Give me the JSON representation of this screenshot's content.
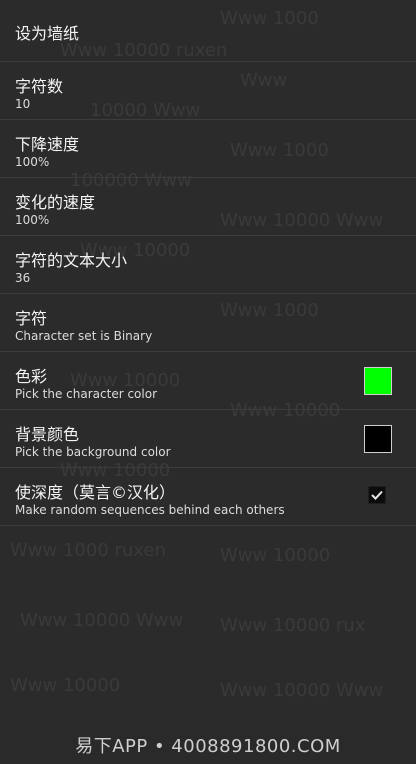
{
  "settings": {
    "items": [
      {
        "title": "设为墙纸"
      },
      {
        "title": "字符数",
        "subtitle": "10"
      },
      {
        "title": "下降速度",
        "subtitle": "100%"
      },
      {
        "title": "变化的速度",
        "subtitle": "100%"
      },
      {
        "title": "字符的文本大小",
        "subtitle": "36"
      },
      {
        "title": "字符",
        "subtitle": "Character set is Binary"
      },
      {
        "title": "色彩",
        "subtitle": "Pick the character color",
        "color": "#00ff00"
      },
      {
        "title": "背景颜色",
        "subtitle": "Pick the background color",
        "color": "#000000"
      },
      {
        "title": "使深度（莫言©汉化）",
        "subtitle": "Make random sequences behind each others",
        "checked": true
      }
    ]
  },
  "footer": {
    "watermark": "易下APP • 4008891800.COM"
  }
}
